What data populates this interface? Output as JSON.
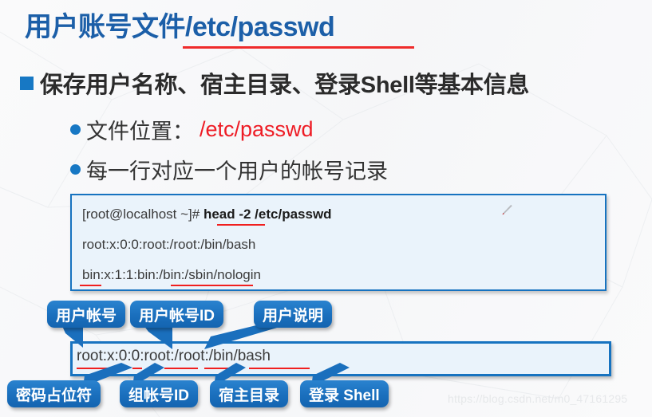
{
  "slide": {
    "title": "用户账号文件/etc/passwd",
    "watermark": "https://blog.csdn.net/m0_47161295"
  },
  "colors": {
    "title_blue": "#1c5fa8",
    "accent_blue": "#1773c0",
    "callout_blue": "#1a6fbd",
    "red": "#ee1c25",
    "box_bg": "#eaf3fb",
    "body_text": "#333333"
  },
  "bullets": {
    "main": {
      "marker": "square-bullet-icon",
      "text": "保存用户名称、宿主目录、登录Shell等基本信息"
    },
    "sub": [
      {
        "marker": "dot-bullet-icon",
        "label": "文件位置：",
        "value": "/etc/passwd",
        "value_color": "#ee1c25"
      },
      {
        "marker": "dot-bullet-icon",
        "label": "每一行对应一个用户的帐号记录",
        "value": "",
        "value_color": ""
      }
    ]
  },
  "terminal": {
    "prompt": "[root@localhost ~]#",
    "command": "head -2 /etc/passwd",
    "output_lines": [
      "root:x:0:0:root:/root:/bin/bash",
      "bin:x:1:1:bin:/bin:/sbin/nologin"
    ],
    "cursor_icon": "pen-cursor-icon"
  },
  "record": {
    "line": "root:x:0:0:root:/root:/bin/bash"
  },
  "callouts_top": [
    {
      "label": "用户帐号"
    },
    {
      "label": "用户帐号ID"
    },
    {
      "label": "用户说明"
    }
  ],
  "callouts_bottom": [
    {
      "label": "密码占位符"
    },
    {
      "label": "组帐号ID"
    },
    {
      "label": "宿主目录"
    },
    {
      "label": "登录 Shell"
    }
  ]
}
